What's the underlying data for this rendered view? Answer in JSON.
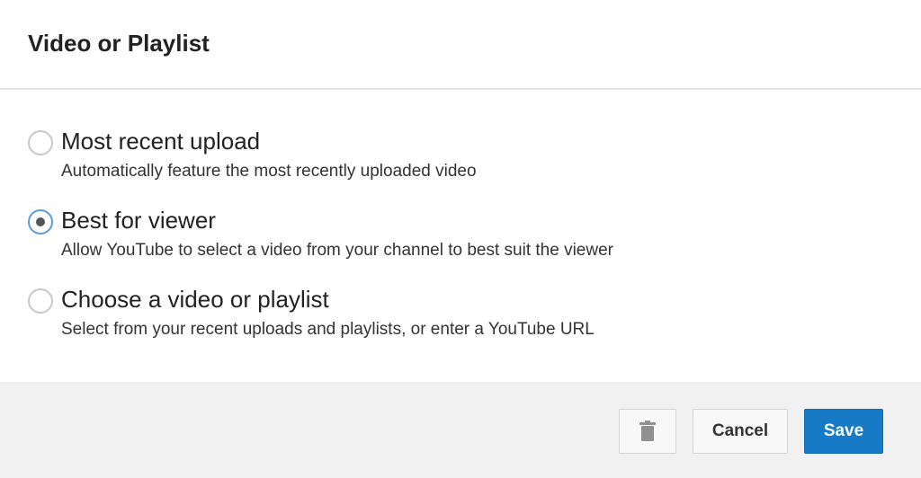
{
  "dialog": {
    "title": "Video or Playlist"
  },
  "options": [
    {
      "label": "Most recent upload",
      "description": "Automatically feature the most recently uploaded video",
      "selected": false
    },
    {
      "label": "Best for viewer",
      "description": "Allow YouTube to select a video from your channel to best suit the viewer",
      "selected": true
    },
    {
      "label": "Choose a video or playlist",
      "description": "Select from your recent uploads and playlists, or enter a YouTube URL",
      "selected": false
    }
  ],
  "footer": {
    "delete_icon": "trash-icon",
    "cancel_label": "Cancel",
    "save_label": "Save"
  },
  "colors": {
    "save_button": "#167ac6",
    "radio_selected_border": "#5b9be0",
    "footer_background": "#f1f1f1"
  }
}
